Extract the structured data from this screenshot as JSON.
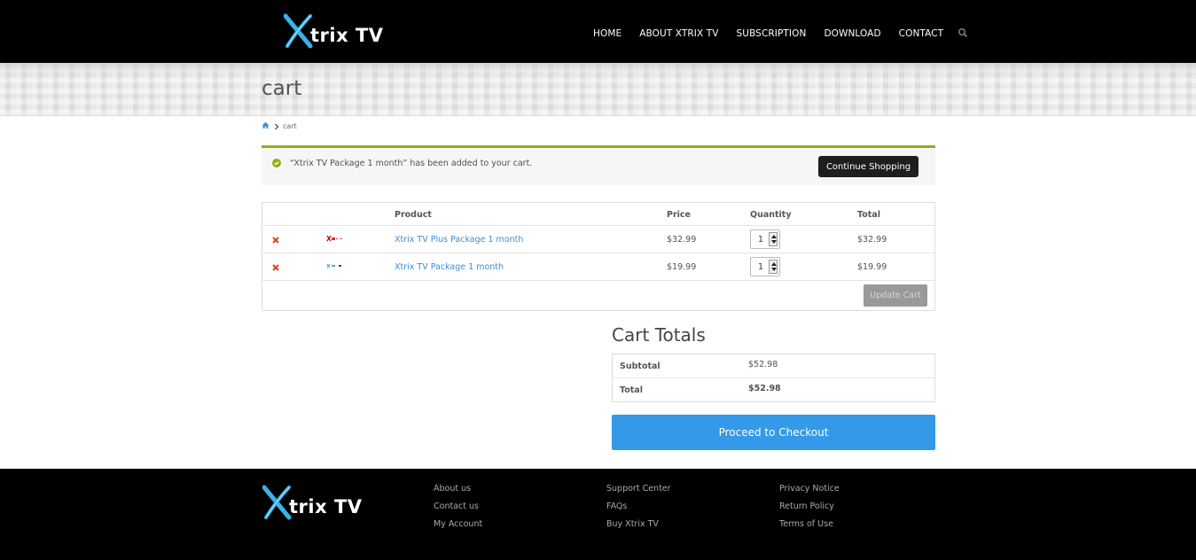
{
  "brand": {
    "name": "Xtrix TV",
    "logo_rest": "trix TV",
    "logo_accent_color": "#3ab3e8"
  },
  "nav": {
    "items": [
      "HOME",
      "ABOUT XTRIX TV",
      "SUBSCRIPTION",
      "DOWNLOAD",
      "CONTACT"
    ],
    "search_icon": "search-icon"
  },
  "page": {
    "title": "cart"
  },
  "breadcrumb": {
    "home_icon": "home-icon",
    "current": "cart"
  },
  "notice": {
    "icon": "check-circle-icon",
    "message": "“Xtrix TV Package 1 month” has been added to your cart.",
    "button": "Continue Shopping"
  },
  "cart": {
    "headers": {
      "product": "Product",
      "price": "Price",
      "quantity": "Quantity",
      "total": "Total"
    },
    "items": [
      {
        "name": "Xtrix TV Plus Package 1 month",
        "price": "$32.99",
        "quantity": "1",
        "total": "$32.99"
      },
      {
        "name": "Xtrix TV Package 1 month",
        "price": "$19.99",
        "quantity": "1",
        "total": "$19.99"
      }
    ],
    "update_button": "Update Cart"
  },
  "totals": {
    "title": "Cart Totals",
    "subtotal_label": "Subtotal",
    "subtotal_value": "$52.98",
    "total_label": "Total",
    "total_value": "$52.98",
    "checkout_button": "Proceed to Checkout"
  },
  "footer": {
    "col1": [
      "About us",
      "Contact us",
      "My Account"
    ],
    "col2": [
      "Support Center",
      "FAQs",
      "Buy Xtrix TV"
    ],
    "col3": [
      "Privacy Notice",
      "Return Policy",
      "Terms of Use"
    ]
  },
  "colors": {
    "header_bg": "#000000",
    "accent_blue": "#3399e8",
    "link_blue": "#3a8fd6",
    "notice_border": "#8fae1b",
    "remove_red": "#e2401c"
  }
}
